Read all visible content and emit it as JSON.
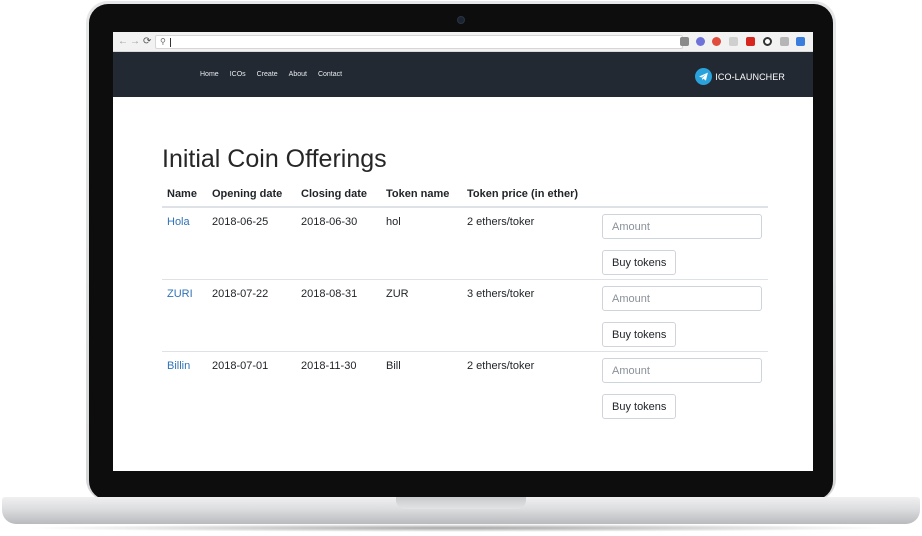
{
  "navbar": {
    "links": [
      "Home",
      "ICOs",
      "Create",
      "About",
      "Contact"
    ],
    "brand": "ICO-LAUNCHER"
  },
  "page": {
    "title": "Initial Coin Offerings"
  },
  "table": {
    "columns": [
      "Name",
      "Opening date",
      "Closing date",
      "Token name",
      "Token price (in ether)"
    ],
    "rows": [
      {
        "name": "Hola",
        "opening": "2018-06-25",
        "closing": "2018-06-30",
        "token": "hol",
        "price": "2 ethers/toker"
      },
      {
        "name": "ZURI",
        "opening": "2018-07-22",
        "closing": "2018-08-31",
        "token": "ZUR",
        "price": "3 ethers/toker"
      },
      {
        "name": "Billin",
        "opening": "2018-07-01",
        "closing": "2018-11-30",
        "token": "Bill",
        "price": "2 ethers/toker"
      }
    ],
    "amount_placeholder": "Amount",
    "buy_label": "Buy tokens"
  },
  "colors": {
    "navbar_bg": "#222933",
    "link": "#2f73b8",
    "brand_icon": "#2aa3dc"
  },
  "icons": [
    "back-arrow-icon",
    "forward-arrow-icon",
    "reload-icon",
    "search-icon",
    "telegram-plane-icon"
  ]
}
